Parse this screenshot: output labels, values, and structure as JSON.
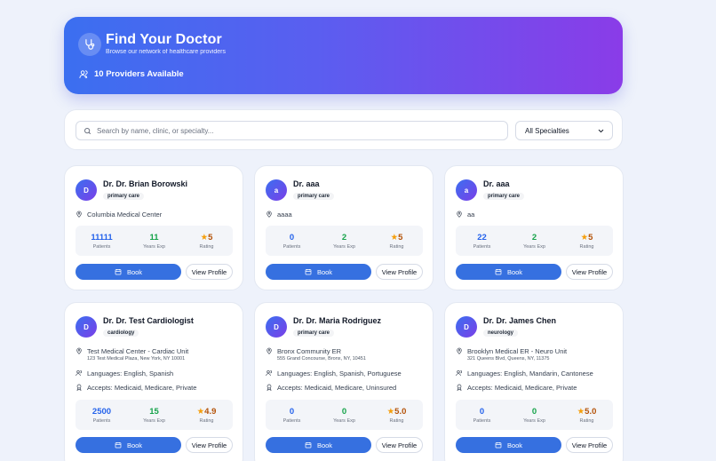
{
  "hero": {
    "title": "Find Your Doctor",
    "subtitle": "Browse our network of healthcare providers",
    "count_text": "10 Providers Available",
    "icon": "stethoscope-icon",
    "count_icon": "users-icon"
  },
  "search": {
    "placeholder": "Search by name, clinic, or specialty...",
    "value": "",
    "filter_value": "All Specialties"
  },
  "labels": {
    "patients": "Patients",
    "years_exp": "Years Exp",
    "rating": "Rating",
    "book": "Book",
    "view_profile": "View Profile"
  },
  "colors": {
    "accent": "#3670e0",
    "gradient_start": "#3b6ff0",
    "gradient_end": "#8a3ce8",
    "patients": "#2563eb",
    "years": "#16a34a",
    "star": "#f59e0b"
  },
  "doctors": [
    {
      "initial": "D",
      "name": "Dr. Dr. Brian Borowski",
      "specialty": "primary care",
      "clinic": "Columbia Medical Center",
      "address": "",
      "languages": "",
      "accepts": "",
      "patients": "11111",
      "years": "11",
      "rating": "5"
    },
    {
      "initial": "a",
      "name": "Dr. aaa",
      "specialty": "primary care",
      "clinic": "aaaa",
      "address": "",
      "languages": "",
      "accepts": "",
      "patients": "0",
      "years": "2",
      "rating": "5"
    },
    {
      "initial": "a",
      "name": "Dr. aaa",
      "specialty": "primary care",
      "clinic": "aa",
      "address": "",
      "languages": "",
      "accepts": "",
      "patients": "22",
      "years": "2",
      "rating": "5"
    },
    {
      "initial": "D",
      "name": "Dr. Dr. Test Cardiologist",
      "specialty": "cardiology",
      "clinic": "Test Medical Center - Cardiac Unit",
      "address": "123 Test Medical Plaza, New York, NY 10001",
      "languages": "Languages: English, Spanish",
      "accepts": "Accepts: Medicaid, Medicare, Private",
      "patients": "2500",
      "years": "15",
      "rating": "4.9"
    },
    {
      "initial": "D",
      "name": "Dr. Dr. Maria Rodriguez",
      "specialty": "primary care",
      "clinic": "Bronx Community ER",
      "address": "555 Grand Concourse, Bronx, NY, 10451",
      "languages": "Languages: English, Spanish, Portuguese",
      "accepts": "Accepts: Medicaid, Medicare, Uninsured",
      "patients": "0",
      "years": "0",
      "rating": "5.0"
    },
    {
      "initial": "D",
      "name": "Dr. Dr. James Chen",
      "specialty": "neurology",
      "clinic": "Brooklyn Medical ER - Neuro Unit",
      "address": "321 Queens Blvd, Queens, NY, 11375",
      "languages": "Languages: English, Mandarin, Cantonese",
      "accepts": "Accepts: Medicaid, Medicare, Private",
      "patients": "0",
      "years": "0",
      "rating": "5.0"
    }
  ]
}
